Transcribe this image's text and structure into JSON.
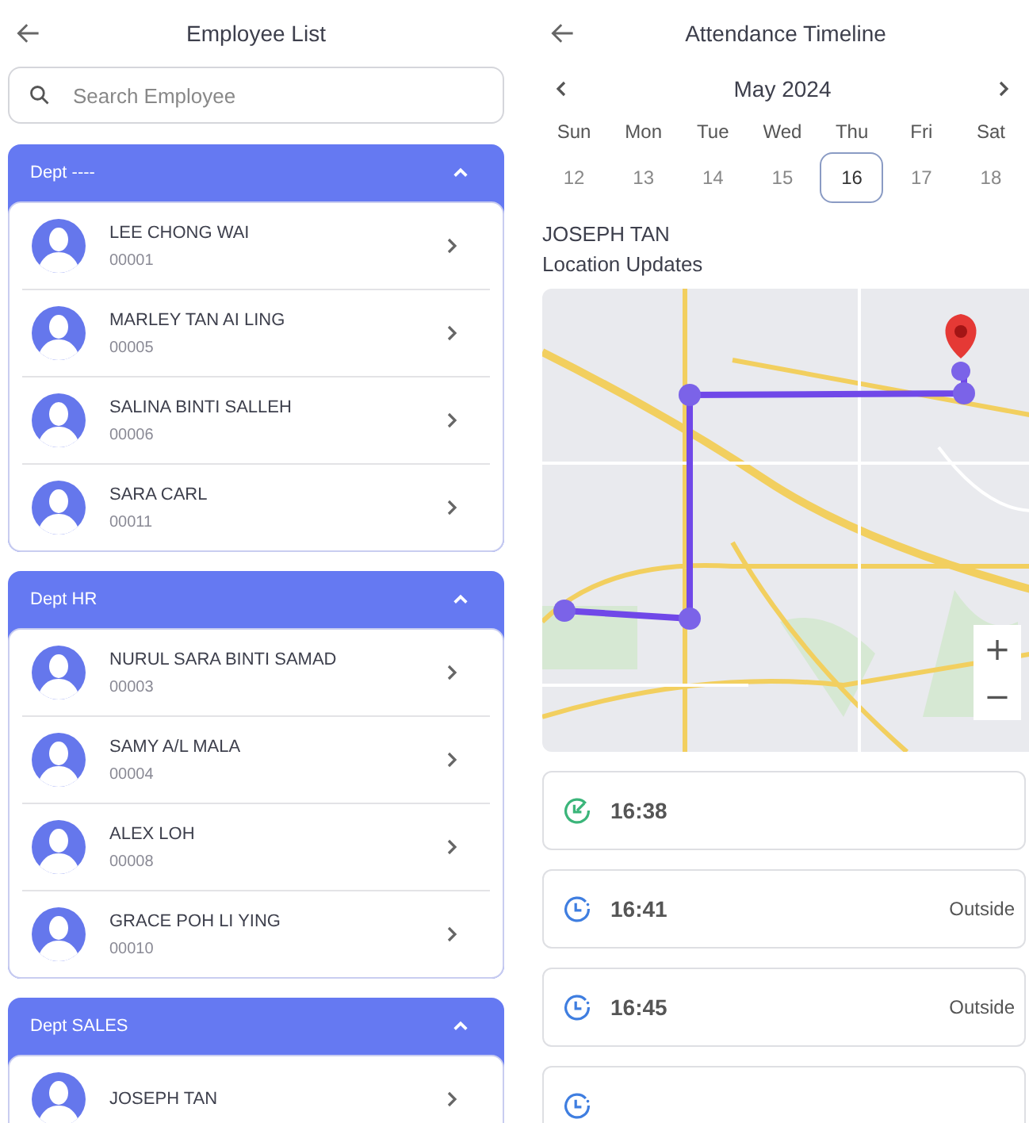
{
  "employee_list": {
    "title": "Employee List",
    "search": {
      "placeholder": "Search Employee"
    },
    "departments": [
      {
        "name": "Dept ----",
        "expanded": true,
        "employees": [
          {
            "name": "LEE CHONG WAI",
            "id": "00001"
          },
          {
            "name": "MARLEY TAN AI LING",
            "id": "00005"
          },
          {
            "name": "SALINA BINTI SALLEH",
            "id": "00006"
          },
          {
            "name": "SARA CARL",
            "id": "00011"
          }
        ]
      },
      {
        "name": "Dept HR",
        "expanded": true,
        "employees": [
          {
            "name": "NURUL SARA BINTI SAMAD",
            "id": "00003"
          },
          {
            "name": "SAMY A/L MALA",
            "id": "00004"
          },
          {
            "name": "ALEX LOH",
            "id": "00008"
          },
          {
            "name": "GRACE POH LI YING",
            "id": "00010"
          }
        ]
      },
      {
        "name": "Dept SALES",
        "expanded": true,
        "employees": [
          {
            "name": "JOSEPH TAN"
          }
        ]
      }
    ]
  },
  "attendance": {
    "title": "Attendance Timeline",
    "month": "May 2024",
    "days": [
      {
        "weekday": "Sun",
        "date": "12",
        "selected": false
      },
      {
        "weekday": "Mon",
        "date": "13",
        "selected": false
      },
      {
        "weekday": "Tue",
        "date": "14",
        "selected": false
      },
      {
        "weekday": "Wed",
        "date": "15",
        "selected": false
      },
      {
        "weekday": "Thu",
        "date": "16",
        "selected": true
      },
      {
        "weekday": "Fri",
        "date": "17",
        "selected": false
      },
      {
        "weekday": "Sat",
        "date": "18",
        "selected": false
      }
    ],
    "employee_name": "JOSEPH TAN",
    "section_title": "Location Updates",
    "map": {
      "zoom_in": "+",
      "zoom_out": "−"
    },
    "entries": [
      {
        "kind": "check-in",
        "time": "16:38"
      },
      {
        "kind": "update",
        "time": "16:41",
        "location": "Outside"
      },
      {
        "kind": "update",
        "time": "16:45",
        "location": "Outside"
      },
      {
        "kind": "update"
      }
    ]
  }
}
